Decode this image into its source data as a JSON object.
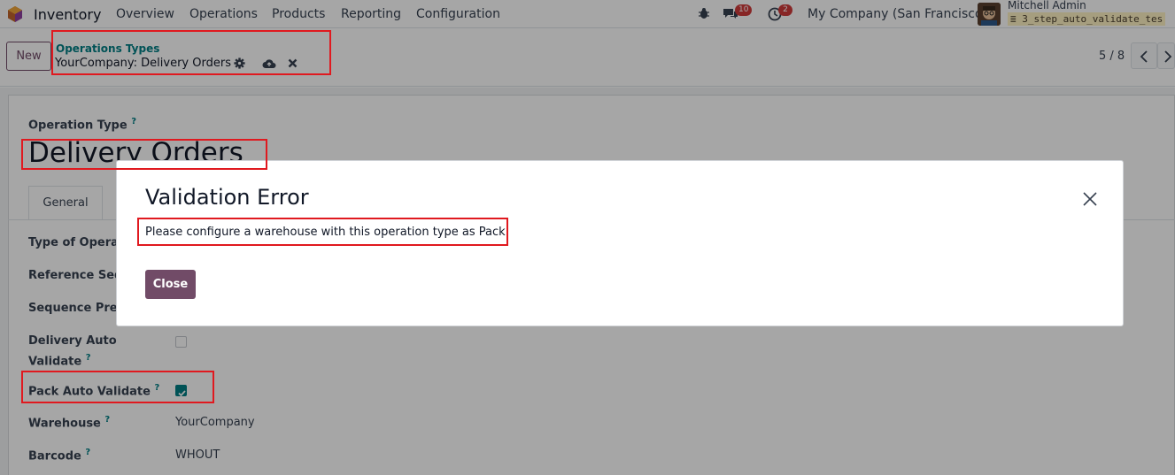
{
  "topbar": {
    "app_name": "Inventory",
    "menu": [
      "Overview",
      "Operations",
      "Products",
      "Reporting",
      "Configuration"
    ],
    "messages_badge": "10",
    "activities_badge": "2",
    "company": "My Company (San Francisco)",
    "user_name": "Mitchell Admin",
    "db_name": "3_step_auto_validate_tes"
  },
  "control": {
    "new_button": "New",
    "breadcrumb_parent": "Operations Types",
    "breadcrumb_current": "YourCompany: Delivery Orders",
    "pager": "5 / 8"
  },
  "form": {
    "operation_type_label": "Operation Type",
    "help_mark": "?",
    "title": "Delivery Orders",
    "tab_general": "General",
    "fields": {
      "type_of_operation": "Type of Operat",
      "reference_sequence": "Reference Sequ",
      "sequence_prefix": "Sequence Prefi",
      "delivery_auto_validate_1": "Delivery Auto",
      "delivery_auto_validate_2": "Validate",
      "pack_auto_validate": "Pack Auto Validate",
      "warehouse": "Warehouse",
      "warehouse_value": "YourCompany",
      "barcode": "Barcode",
      "barcode_value": "WHOUT"
    },
    "delivery_auto_validate_checked": false,
    "pack_auto_validate_checked": true
  },
  "dialog": {
    "title": "Validation Error",
    "message": "Please configure a warehouse with this operation type as Pack.",
    "close_button": "Close"
  },
  "colors": {
    "brand": "#714b67",
    "accent": "#017e84",
    "highlight": "#e0191f"
  }
}
